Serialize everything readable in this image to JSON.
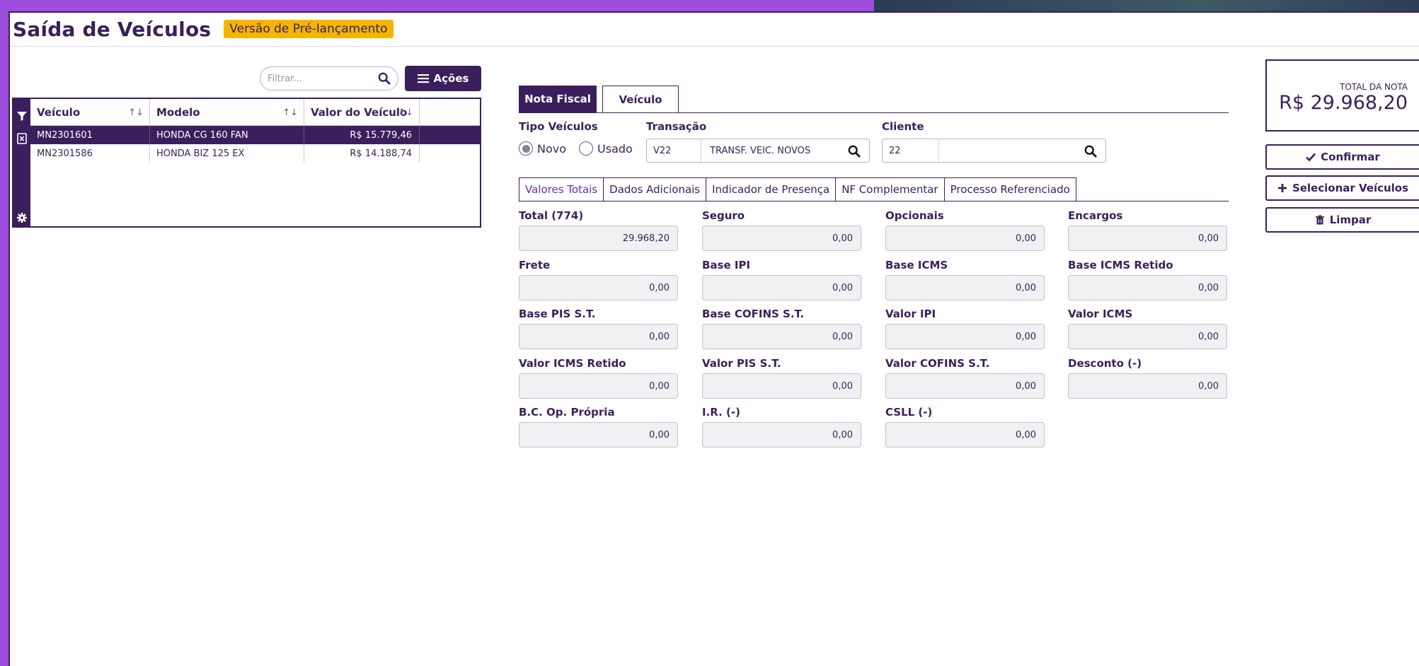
{
  "header": {
    "title": "Saída de Veículos",
    "badge": "Versão de Pré-lançamento"
  },
  "toolbar": {
    "filter_placeholder": "Filtrar...",
    "actions_label": "Ações"
  },
  "grid": {
    "columns": [
      "Veículo",
      "Modelo",
      "Valor do Veículo"
    ],
    "rows": [
      {
        "veiculo": "MN2301601",
        "modelo": "HONDA CG 160 FAN",
        "valor": "R$ 15.779,46",
        "selected": true
      },
      {
        "veiculo": "MN2301586",
        "modelo": "HONDA BIZ 125 EX",
        "valor": "R$ 14.188,74",
        "selected": false
      }
    ]
  },
  "tabs": {
    "nota_fiscal": "Nota Fiscal",
    "veiculo": "Veículo"
  },
  "form": {
    "tipo_veiculos_label": "Tipo Veículos",
    "tipo_options": [
      "Novo",
      "Usado"
    ],
    "tipo_selected": "Novo",
    "transacao_label": "Transação",
    "transacao_code": "V22",
    "transacao_desc": "TRANSF. VEIC. NOVOS",
    "cliente_label": "Cliente",
    "cliente_code": "22",
    "cliente_name": ""
  },
  "sub_tabs": [
    "Valores Totais",
    "Dados Adicionais",
    "Indicador de Presença",
    "NF Complementar",
    "Processo Referenciado"
  ],
  "fields": [
    {
      "label": "Total (774)",
      "value": "29.968,20"
    },
    {
      "label": "Seguro",
      "value": "0,00"
    },
    {
      "label": "Opcionais",
      "value": "0,00"
    },
    {
      "label": "Encargos",
      "value": "0,00"
    },
    {
      "label": "Frete",
      "value": "0,00"
    },
    {
      "label": "Base IPI",
      "value": "0,00"
    },
    {
      "label": "Base ICMS",
      "value": "0,00"
    },
    {
      "label": "Base ICMS Retido",
      "value": "0,00"
    },
    {
      "label": "Base PIS S.T.",
      "value": "0,00"
    },
    {
      "label": "Base COFINS S.T.",
      "value": "0,00"
    },
    {
      "label": "Valor IPI",
      "value": "0,00"
    },
    {
      "label": "Valor ICMS",
      "value": "0,00"
    },
    {
      "label": "Valor ICMS Retido",
      "value": "0,00"
    },
    {
      "label": "Valor PIS S.T.",
      "value": "0,00"
    },
    {
      "label": "Valor COFINS S.T.",
      "value": "0,00"
    },
    {
      "label": "Desconto (-)",
      "value": "0,00"
    },
    {
      "label": "B.C. Op. Própria",
      "value": "0,00"
    },
    {
      "label": "I.R. (-)",
      "value": "0,00"
    },
    {
      "label": "CSLL (-)",
      "value": "0,00"
    }
  ],
  "summary": {
    "total_label": "TOTAL DA NOTA",
    "total_value": "R$ 29.968,20"
  },
  "actions": {
    "confirm": "Confirmar",
    "select": "Selecionar Veículos",
    "clear": "Limpar"
  },
  "colors": {
    "primary": "#3a1f5c",
    "accent": "#f6b400",
    "frame": "#9d4edd"
  }
}
